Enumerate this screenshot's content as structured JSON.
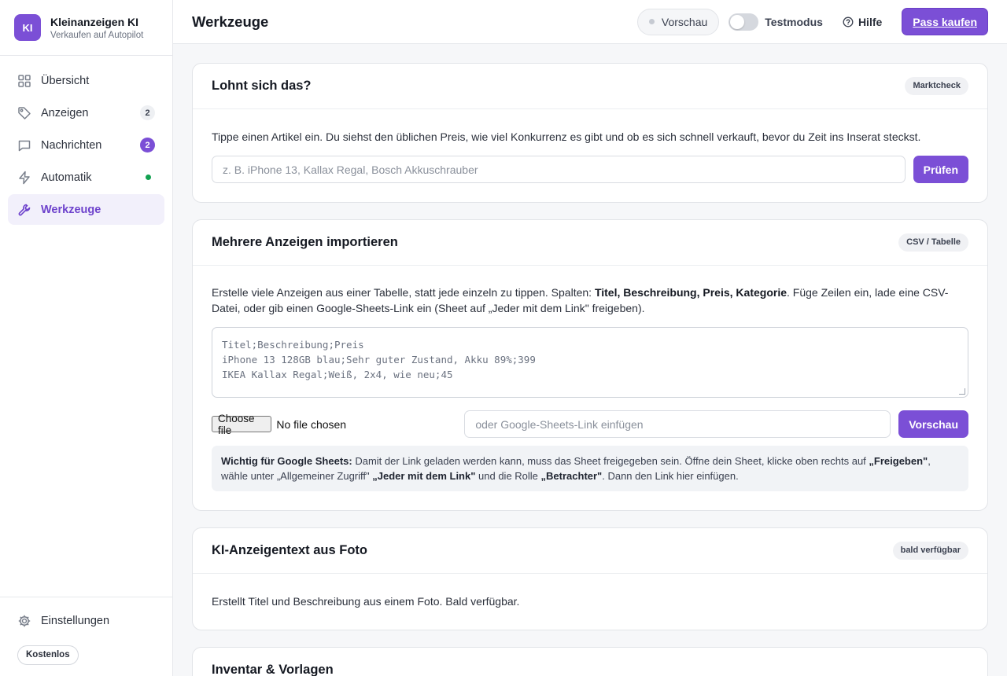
{
  "brand": {
    "logo": "KI",
    "title": "Kleinanzeigen KI",
    "subtitle": "Verkaufen auf Autopilot"
  },
  "sidebar": {
    "items": [
      {
        "label": "Übersicht",
        "icon": "grid-icon"
      },
      {
        "label": "Anzeigen",
        "icon": "tag-icon",
        "count": "2"
      },
      {
        "label": "Nachrichten",
        "icon": "chat-icon",
        "count": "2"
      },
      {
        "label": "Automatik",
        "icon": "lightning-icon",
        "status": "active"
      },
      {
        "label": "Werkzeuge",
        "icon": "wrench-icon",
        "active": true
      }
    ],
    "settings": "Einstellungen",
    "plan": "Kostenlos"
  },
  "header": {
    "title": "Werkzeuge",
    "preview": "Vorschau",
    "test_mode": "Testmodus",
    "test_mode_on": false,
    "help": "Hilfe",
    "buy": "Pass kaufen"
  },
  "cards": {
    "market": {
      "title": "Lohnt sich das?",
      "tag": "Marktcheck",
      "desc": "Tippe einen Artikel ein. Du siehst den üblichen Preis, wie viel Konkurrenz es gibt und ob es sich schnell verkauft, bevor du Zeit ins Inserat steckst.",
      "placeholder": "z. B. iPhone 13, Kallax Regal, Bosch Akkuschrauber",
      "button": "Prüfen"
    },
    "import": {
      "title": "Mehrere Anzeigen importieren",
      "tag": "CSV / Tabelle",
      "desc_1": "Erstelle viele Anzeigen aus einer Tabelle, statt jede einzeln zu tippen. Spalten: ",
      "desc_bold": "Titel, Beschreibung, Preis, Kategorie",
      "desc_2": ". Füge Zeilen ein, lade eine CSV-Datei, oder gib einen Google-Sheets-Link ein (Sheet auf „Jeder mit dem Link\" freigeben).",
      "textarea_lines": [
        "Titel;Beschreibung;Preis",
        "iPhone 13 128GB blau;Sehr guter Zustand, Akku 89%;399",
        "IKEA Kallax Regal;Weiß, 2x4, wie neu;45"
      ],
      "file_button": "Choose file",
      "file_status": "No file chosen",
      "link_placeholder": "oder Google-Sheets-Link einfügen",
      "button": "Vorschau",
      "note_b1": "Wichtig für Google Sheets:",
      "note_t1": " Damit der Link geladen werden kann, muss das Sheet freigegeben sein. Öffne dein Sheet, klicke oben rechts auf ",
      "note_b2": "„Freigeben\"",
      "note_t2": ", wähle unter „Allgemeiner Zugriff\" ",
      "note_b3": "„Jeder mit dem Link\"",
      "note_t3": " und die Rolle ",
      "note_b4": "„Betrachter\"",
      "note_t4": ". Dann den Link hier einfügen."
    },
    "photo": {
      "title": "KI-Anzeigentext aus Foto",
      "tag": "bald verfügbar",
      "desc": "Erstellt Titel und Beschreibung aus einem Foto. Bald verfügbar."
    },
    "inventory": {
      "title": "Inventar & Vorlagen"
    }
  },
  "colors": {
    "accent": "#7b4fd6",
    "active_bg": "#f2f0fb",
    "status_green": "#12a150"
  }
}
